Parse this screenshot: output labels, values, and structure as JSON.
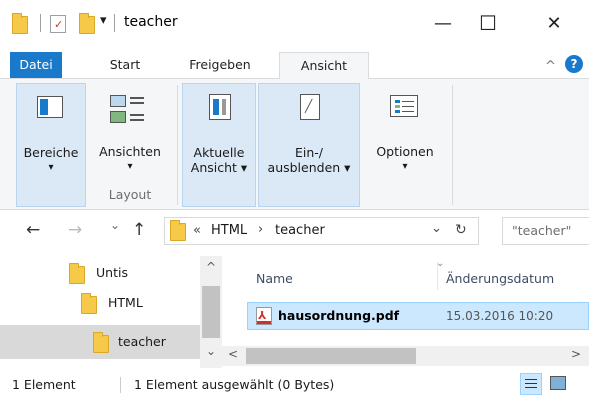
{
  "window": {
    "title": "teacher",
    "qat_dropdown": "▾",
    "minimize": "—",
    "maximize": "☐",
    "close": "✕"
  },
  "ribbon_tabs": {
    "file": "Datei",
    "start": "Start",
    "share": "Freigeben",
    "view": "Ansicht",
    "collapse": "^",
    "help": "?"
  },
  "ribbon": {
    "panes_label": "Bereiche",
    "layout_views_label": "Ansichten",
    "layout_group_label": "Layout",
    "current_view_line1": "Aktuelle",
    "current_view_line2": "Ansicht ▾",
    "show_hide_line1": "Ein-/",
    "show_hide_line2": "ausblenden ▾",
    "options_label": "Optionen",
    "caret": "▾"
  },
  "nav": {
    "back": "←",
    "forward": "→",
    "recent": "⌄",
    "up": "↑",
    "breadcrumb_overflow": "«",
    "crumb1": "HTML",
    "crumb_sep": "›",
    "crumb2": "teacher",
    "addr_dropdown": "⌄",
    "refresh": "↻",
    "search_placeholder": "\"teacher\""
  },
  "tree": [
    {
      "label": "Untis"
    },
    {
      "label": "HTML"
    },
    {
      "label": "teacher"
    }
  ],
  "columns": {
    "name": "Name",
    "modified": "Änderungsdatum",
    "sort_arrow": "⌄"
  },
  "files": [
    {
      "name": "hausordnung.pdf",
      "modified": "15.03.2016 10:20",
      "icon": "pdf-icon"
    }
  ],
  "scroll": {
    "up": "^",
    "down": "⌄",
    "left": "<",
    "right": ">"
  },
  "status": {
    "count": "1 Element",
    "selection": "1 Element ausgewählt (0 Bytes)"
  },
  "colors": {
    "accent": "#1979ca",
    "selection": "#cce8ff",
    "ribbon_selected": "#dbe9f7",
    "folder": "#f7c948"
  }
}
